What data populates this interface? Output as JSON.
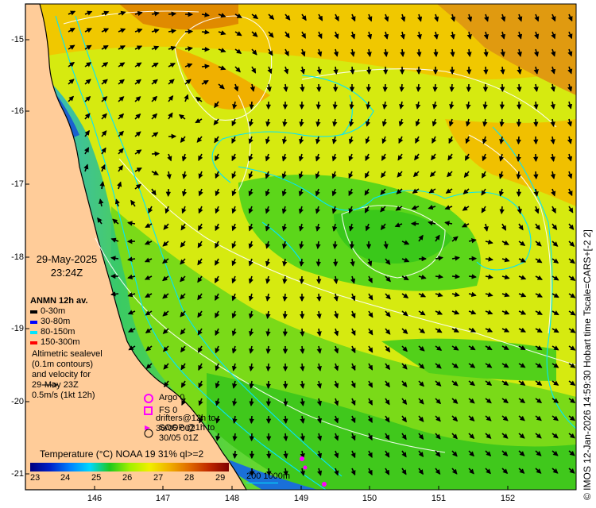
{
  "date": "29-May-2025",
  "time": "23:24Z",
  "anmn": {
    "title": "ANMN 12h av.",
    "items": [
      {
        "label": "0-30m",
        "color": "#000000"
      },
      {
        "label": "30-80m",
        "color": "#0000ff"
      },
      {
        "label": "80-150m",
        "color": "#00e5ff"
      },
      {
        "label": "150-300m",
        "color": "#ff0000"
      }
    ]
  },
  "altimetry": {
    "lines": [
      "Altimetric sealevel",
      "(0.1m contours)",
      "and velocity for",
      "29-May 23Z",
      "0.5m/s (1kt 12h)"
    ]
  },
  "observations": {
    "argo": "Argo 0",
    "fs": "FS 0",
    "drifters_line1": "drifters@12h to",
    "drifters_line2": "30/05 00Z",
    "soop_line1": "SOOP @1h to",
    "soop_line2": "30/05 01Z",
    "marker_color": "#ff00ff"
  },
  "temperature": {
    "title": "Temperature (°C) NOAA 19 31% ql>=2",
    "ticks": [
      "23",
      "24",
      "25",
      "26",
      "27",
      "28",
      "29"
    ],
    "colors": [
      "#00007f",
      "#0020c8",
      "#0080ff",
      "#00d8ff",
      "#1ec81e",
      "#a0f000",
      "#f0f000",
      "#f0b000",
      "#e06a00",
      "#c02800",
      "#800000"
    ]
  },
  "depth_legend": {
    "a": "200",
    "b": "1000m",
    "color": "#00e5ff"
  },
  "credit": "© IMOS 12-Jan-2026 14:59:30 Hobart time Tscale=CARS+[-2 2]",
  "lat_labels": [
    "-15",
    "-16",
    "-17",
    "-18",
    "-19",
    "-20",
    "-21"
  ],
  "lon_labels": [
    "146",
    "147",
    "148",
    "149",
    "150",
    "151",
    "152"
  ],
  "land_color": "#ffcc99",
  "contour_color": "#ffffff",
  "isobath_color": "#00e5ff"
}
